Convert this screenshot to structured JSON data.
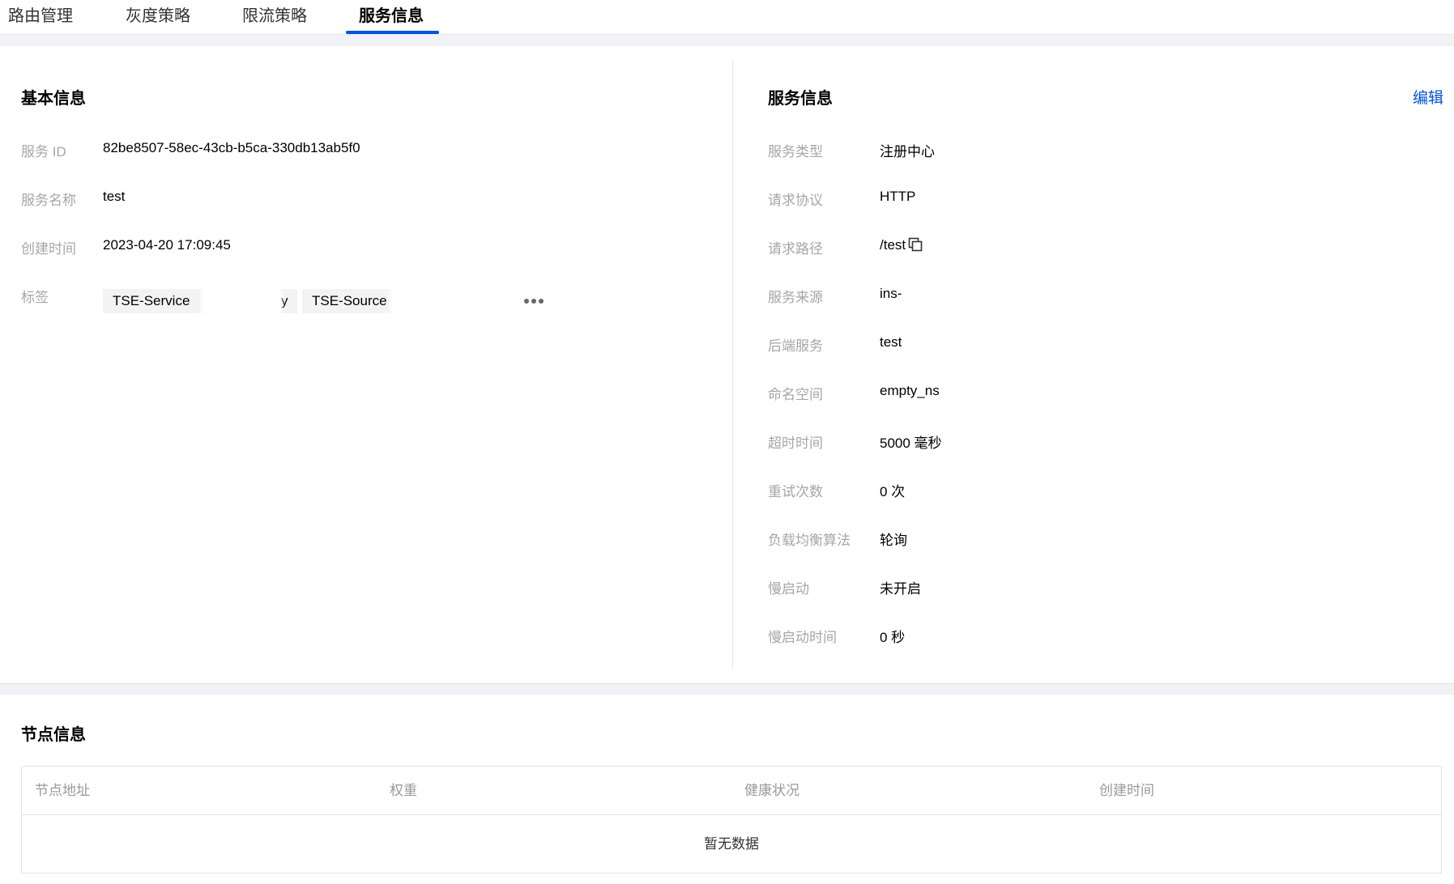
{
  "tabs": [
    {
      "label": "路由管理"
    },
    {
      "label": "灰度策略"
    },
    {
      "label": "限流策略"
    },
    {
      "label": "服务信息"
    }
  ],
  "basic": {
    "title": "基本信息",
    "rows": [
      {
        "label": "服务 ID",
        "value": "82be8507-58ec-43cb-b5ca-330db13ab5f0"
      },
      {
        "label": "服务名称",
        "value": "test"
      },
      {
        "label": "创建时间",
        "value": "2023-04-20 17:09:45"
      }
    ],
    "tags_label": "标签",
    "tags": [
      "TSE-Service",
      "y",
      "TSE-Source"
    ]
  },
  "service": {
    "title": "服务信息",
    "edit_label": "编辑",
    "rows": [
      {
        "label": "服务类型",
        "value": "注册中心"
      },
      {
        "label": "请求协议",
        "value": "HTTP"
      },
      {
        "label": "请求路径",
        "value": "/test"
      },
      {
        "label": "服务来源",
        "value": "ins-"
      },
      {
        "label": "后端服务",
        "value": "test"
      },
      {
        "label": "命名空间",
        "value": "empty_ns"
      },
      {
        "label": "超时时间",
        "value": "5000 毫秒"
      },
      {
        "label": "重试次数",
        "value": "0 次"
      },
      {
        "label": "负载均衡算法",
        "value": "轮询"
      },
      {
        "label": "慢启动",
        "value": "未开启"
      },
      {
        "label": "慢启动时间",
        "value": "0 秒"
      }
    ]
  },
  "nodes": {
    "title": "节点信息",
    "columns": [
      "节点地址",
      "权重",
      "健康状况",
      "创建时间"
    ],
    "empty_text": "暂无数据"
  },
  "colors": {
    "accent": "#0052d9",
    "label": "#a6a6a6",
    "border": "#e3e3e3"
  }
}
